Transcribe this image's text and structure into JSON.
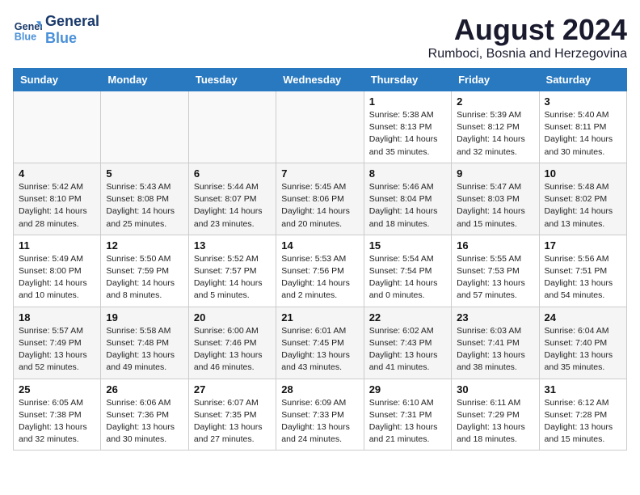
{
  "logo": {
    "line1": "General",
    "line2": "Blue"
  },
  "title": "August 2024",
  "location": "Rumboci, Bosnia and Herzegovina",
  "weekdays": [
    "Sunday",
    "Monday",
    "Tuesday",
    "Wednesday",
    "Thursday",
    "Friday",
    "Saturday"
  ],
  "weeks": [
    [
      {
        "day": "",
        "info": ""
      },
      {
        "day": "",
        "info": ""
      },
      {
        "day": "",
        "info": ""
      },
      {
        "day": "",
        "info": ""
      },
      {
        "day": "1",
        "info": "Sunrise: 5:38 AM\nSunset: 8:13 PM\nDaylight: 14 hours\nand 35 minutes."
      },
      {
        "day": "2",
        "info": "Sunrise: 5:39 AM\nSunset: 8:12 PM\nDaylight: 14 hours\nand 32 minutes."
      },
      {
        "day": "3",
        "info": "Sunrise: 5:40 AM\nSunset: 8:11 PM\nDaylight: 14 hours\nand 30 minutes."
      }
    ],
    [
      {
        "day": "4",
        "info": "Sunrise: 5:42 AM\nSunset: 8:10 PM\nDaylight: 14 hours\nand 28 minutes."
      },
      {
        "day": "5",
        "info": "Sunrise: 5:43 AM\nSunset: 8:08 PM\nDaylight: 14 hours\nand 25 minutes."
      },
      {
        "day": "6",
        "info": "Sunrise: 5:44 AM\nSunset: 8:07 PM\nDaylight: 14 hours\nand 23 minutes."
      },
      {
        "day": "7",
        "info": "Sunrise: 5:45 AM\nSunset: 8:06 PM\nDaylight: 14 hours\nand 20 minutes."
      },
      {
        "day": "8",
        "info": "Sunrise: 5:46 AM\nSunset: 8:04 PM\nDaylight: 14 hours\nand 18 minutes."
      },
      {
        "day": "9",
        "info": "Sunrise: 5:47 AM\nSunset: 8:03 PM\nDaylight: 14 hours\nand 15 minutes."
      },
      {
        "day": "10",
        "info": "Sunrise: 5:48 AM\nSunset: 8:02 PM\nDaylight: 14 hours\nand 13 minutes."
      }
    ],
    [
      {
        "day": "11",
        "info": "Sunrise: 5:49 AM\nSunset: 8:00 PM\nDaylight: 14 hours\nand 10 minutes."
      },
      {
        "day": "12",
        "info": "Sunrise: 5:50 AM\nSunset: 7:59 PM\nDaylight: 14 hours\nand 8 minutes."
      },
      {
        "day": "13",
        "info": "Sunrise: 5:52 AM\nSunset: 7:57 PM\nDaylight: 14 hours\nand 5 minutes."
      },
      {
        "day": "14",
        "info": "Sunrise: 5:53 AM\nSunset: 7:56 PM\nDaylight: 14 hours\nand 2 minutes."
      },
      {
        "day": "15",
        "info": "Sunrise: 5:54 AM\nSunset: 7:54 PM\nDaylight: 14 hours\nand 0 minutes."
      },
      {
        "day": "16",
        "info": "Sunrise: 5:55 AM\nSunset: 7:53 PM\nDaylight: 13 hours\nand 57 minutes."
      },
      {
        "day": "17",
        "info": "Sunrise: 5:56 AM\nSunset: 7:51 PM\nDaylight: 13 hours\nand 54 minutes."
      }
    ],
    [
      {
        "day": "18",
        "info": "Sunrise: 5:57 AM\nSunset: 7:49 PM\nDaylight: 13 hours\nand 52 minutes."
      },
      {
        "day": "19",
        "info": "Sunrise: 5:58 AM\nSunset: 7:48 PM\nDaylight: 13 hours\nand 49 minutes."
      },
      {
        "day": "20",
        "info": "Sunrise: 6:00 AM\nSunset: 7:46 PM\nDaylight: 13 hours\nand 46 minutes."
      },
      {
        "day": "21",
        "info": "Sunrise: 6:01 AM\nSunset: 7:45 PM\nDaylight: 13 hours\nand 43 minutes."
      },
      {
        "day": "22",
        "info": "Sunrise: 6:02 AM\nSunset: 7:43 PM\nDaylight: 13 hours\nand 41 minutes."
      },
      {
        "day": "23",
        "info": "Sunrise: 6:03 AM\nSunset: 7:41 PM\nDaylight: 13 hours\nand 38 minutes."
      },
      {
        "day": "24",
        "info": "Sunrise: 6:04 AM\nSunset: 7:40 PM\nDaylight: 13 hours\nand 35 minutes."
      }
    ],
    [
      {
        "day": "25",
        "info": "Sunrise: 6:05 AM\nSunset: 7:38 PM\nDaylight: 13 hours\nand 32 minutes."
      },
      {
        "day": "26",
        "info": "Sunrise: 6:06 AM\nSunset: 7:36 PM\nDaylight: 13 hours\nand 30 minutes."
      },
      {
        "day": "27",
        "info": "Sunrise: 6:07 AM\nSunset: 7:35 PM\nDaylight: 13 hours\nand 27 minutes."
      },
      {
        "day": "28",
        "info": "Sunrise: 6:09 AM\nSunset: 7:33 PM\nDaylight: 13 hours\nand 24 minutes."
      },
      {
        "day": "29",
        "info": "Sunrise: 6:10 AM\nSunset: 7:31 PM\nDaylight: 13 hours\nand 21 minutes."
      },
      {
        "day": "30",
        "info": "Sunrise: 6:11 AM\nSunset: 7:29 PM\nDaylight: 13 hours\nand 18 minutes."
      },
      {
        "day": "31",
        "info": "Sunrise: 6:12 AM\nSunset: 7:28 PM\nDaylight: 13 hours\nand 15 minutes."
      }
    ]
  ]
}
